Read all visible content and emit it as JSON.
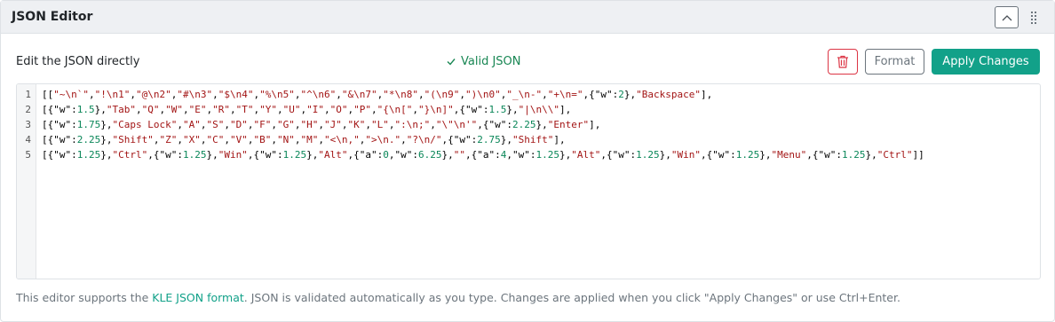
{
  "panel": {
    "title": "JSON Editor"
  },
  "icons": {
    "collapse": "chevron-up-icon",
    "drag": "drag-handle-icon",
    "check": "check-icon",
    "delete": "trash-icon"
  },
  "toolbar": {
    "label": "Edit the JSON directly",
    "status": "Valid JSON",
    "format_label": "Format",
    "apply_label": "Apply Changes"
  },
  "colors": {
    "accent": "#12a189",
    "valid": "#198754",
    "danger": "#dc3545",
    "string": "#a31515",
    "number": "#098658"
  },
  "editor": {
    "lines": [
      "[[\"~\\n`\",\"!\\n1\",\"@\\n2\",\"#\\n3\",\"$\\n4\",\"%\\n5\",\"^\\n6\",\"&\\n7\",\"*\\n8\",\"(\\n9\",\")\\n0\",\"_\\n-\",\"+\\n=\",{\"w\":2},\"Backspace\"],",
      "[{\"w\":1.5},\"Tab\",\"Q\",\"W\",\"E\",\"R\",\"T\",\"Y\",\"U\",\"I\",\"O\",\"P\",\"{\\n[\",\"}\\n]\",{\"w\":1.5},\"|\\n\\\\\"],",
      "[{\"w\":1.75},\"Caps Lock\",\"A\",\"S\",\"D\",\"F\",\"G\",\"H\",\"J\",\"K\",\"L\",\":\\n;\",\"\\\"\\n'\",{\"w\":2.25},\"Enter\"],",
      "[{\"w\":2.25},\"Shift\",\"Z\",\"X\",\"C\",\"V\",\"B\",\"N\",\"M\",\"<\\n,\",\">\\n.\",\"?\\n/\",{\"w\":2.75},\"Shift\"],",
      "[{\"w\":1.25},\"Ctrl\",{\"w\":1.25},\"Win\",{\"w\":1.25},\"Alt\",{\"a\":0,\"w\":6.25},\"\",{\"a\":4,\"w\":1.25},\"Alt\",{\"w\":1.25},\"Win\",{\"w\":1.25},\"Menu\",{\"w\":1.25},\"Ctrl\"]]"
    ]
  },
  "footer": {
    "before": "This editor supports the ",
    "link": "KLE JSON format",
    "after": ". JSON is validated automatically as you type. Changes are applied when you click \"Apply Changes\" or use Ctrl+Enter."
  }
}
